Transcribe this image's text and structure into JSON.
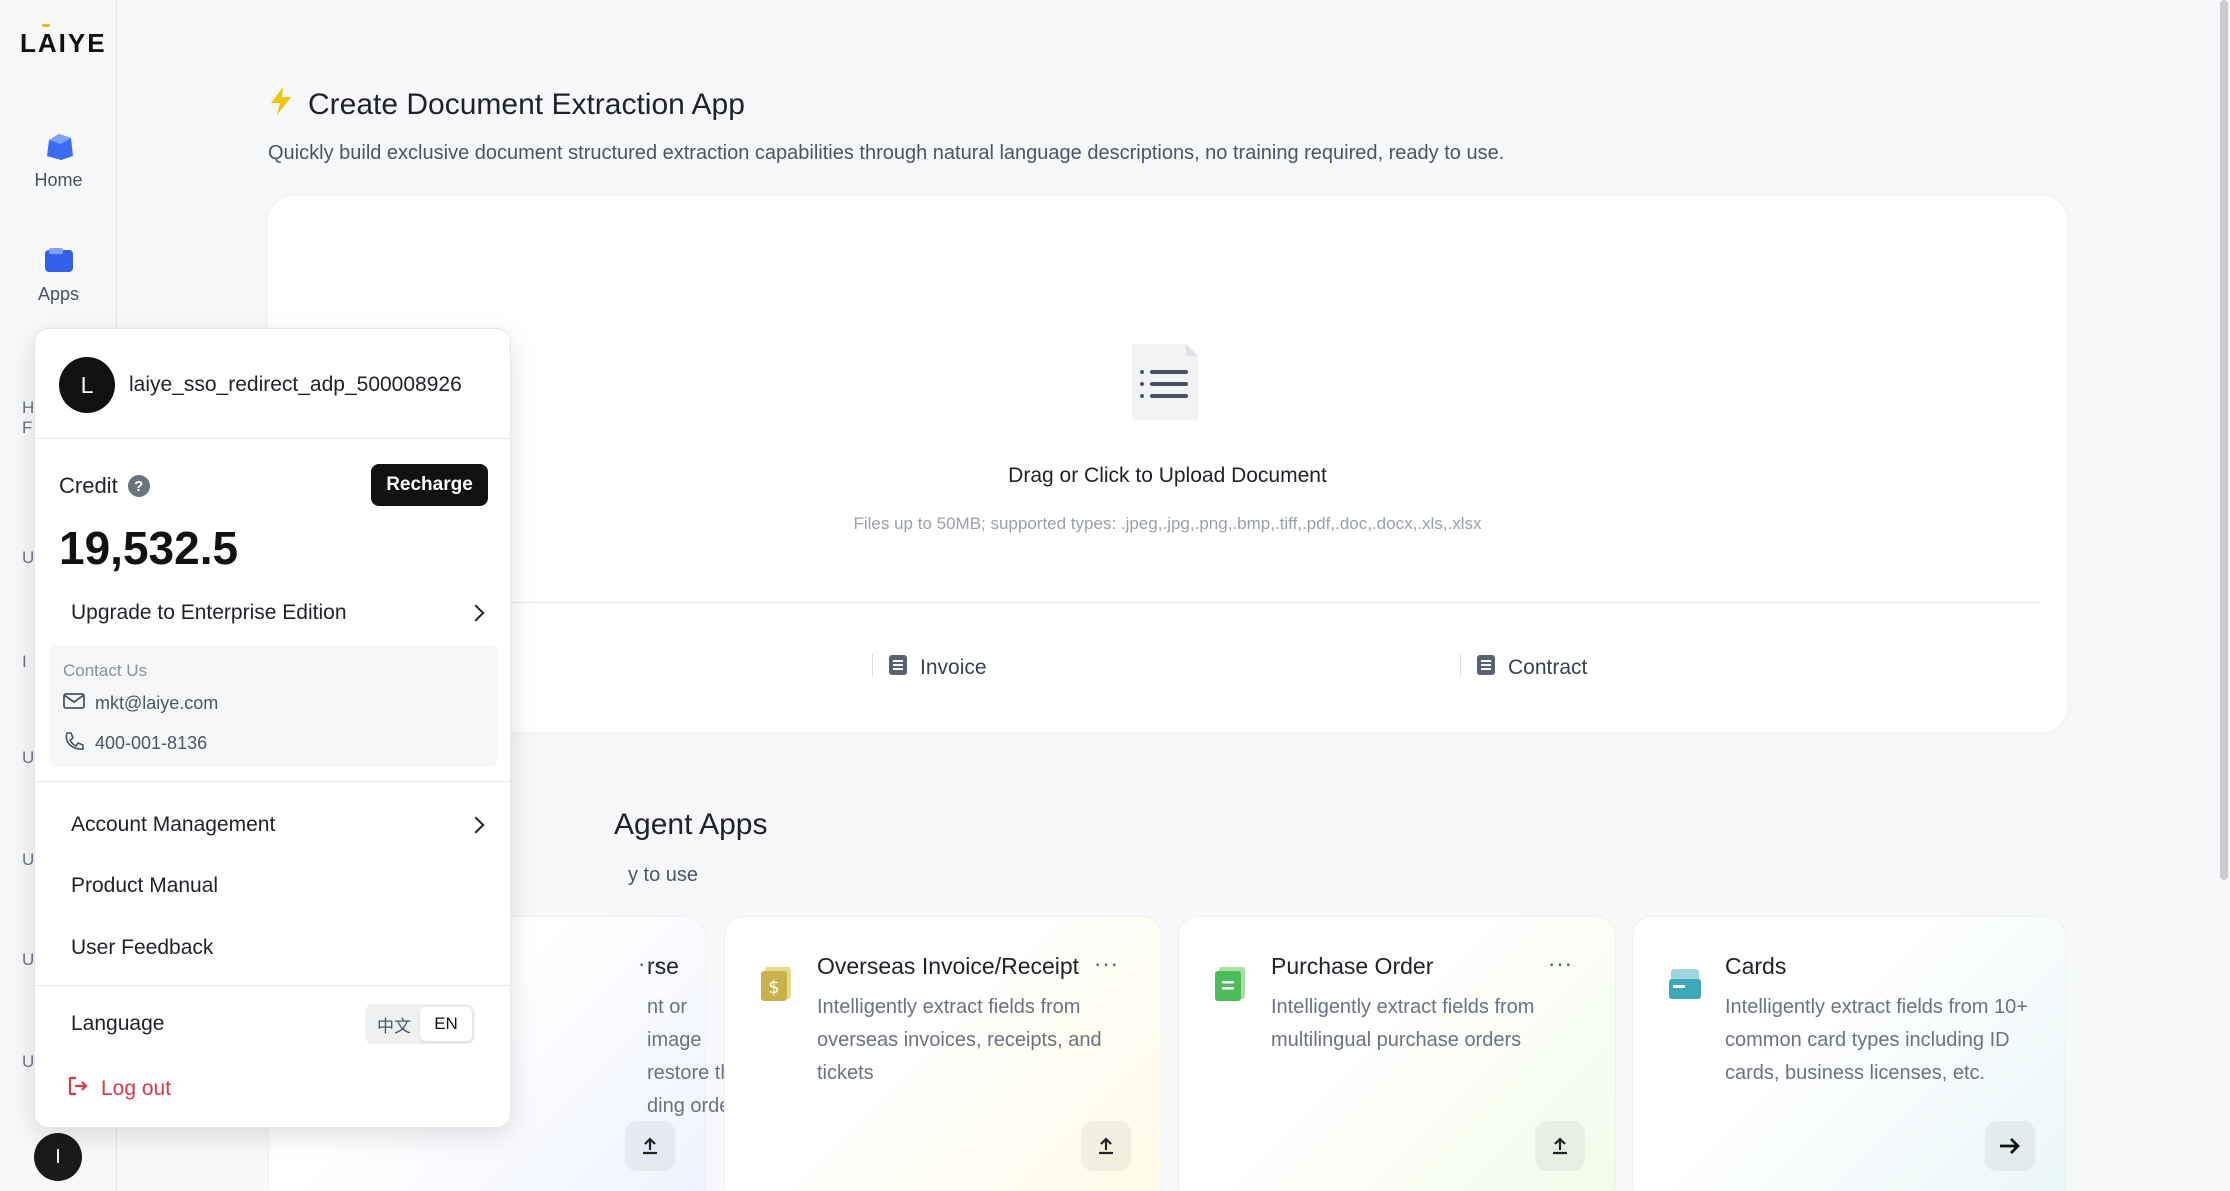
{
  "sidebar": {
    "logo": "LAIYE",
    "items": [
      {
        "label": "Home",
        "icon": "home-icon"
      },
      {
        "label": "Apps",
        "icon": "apps-icon"
      }
    ],
    "partial_letters": [
      "H",
      "F",
      "U",
      "I",
      "U",
      "U",
      "U",
      "U"
    ],
    "bottom_avatar": "I"
  },
  "header": {
    "title": "Create Document Extraction App",
    "title_icon": "lightning-icon",
    "subtitle": "Quickly build exclusive document structured extraction capabilities through natural language descriptions, no training required, ready to use."
  },
  "upload": {
    "prompt": "Drag or Click to Upload Document",
    "hint": "Files up to 50MB; supported types: .jpeg,.jpg,.png,.bmp,.tiff,.pdf,.doc,.docx,.xls,.xlsx",
    "samples": [
      "Invoice",
      "Contract"
    ]
  },
  "agent_section": {
    "title_visible": "Agent Apps",
    "subtitle_visible": "y to use"
  },
  "cards": [
    {
      "title": "rse",
      "desc": "nt or image restore the ding order",
      "more": "···",
      "action": "upload-icon"
    },
    {
      "title": "Overseas Invoice/Receipt",
      "desc": "Intelligently extract fields from overseas invoices, receipts, and tickets",
      "more": "···",
      "action": "upload-icon"
    },
    {
      "title": "Purchase Order",
      "desc": "Intelligently extract fields from multilingual purchase orders",
      "more": "···",
      "action": "upload-icon"
    },
    {
      "title": "Cards",
      "desc": "Intelligently extract fields from 10+ common card types including ID cards, business licenses, etc.",
      "more": "",
      "action": "arrow-right-icon"
    }
  ],
  "popover": {
    "avatar_letter": "L",
    "username": "laiye_sso_redirect_adp_500008926",
    "credit_label": "Credit",
    "recharge": "Recharge",
    "credit_value": "19,532.5",
    "upgrade": "Upgrade to Enterprise Edition",
    "contact_title": "Contact Us",
    "email": "mkt@laiye.com",
    "phone": "400-001-8136",
    "account_management": "Account Management",
    "product_manual": "Product Manual",
    "user_feedback": "User Feedback",
    "language_label": "Language",
    "lang_zh": "中文",
    "lang_en": "EN",
    "lang_selected": "EN",
    "logout": "Log out"
  },
  "colors": {
    "accent": "#111111",
    "logout": "#e0364a",
    "lightning": "#f5c400",
    "home_icon": "#3b6cf6"
  }
}
